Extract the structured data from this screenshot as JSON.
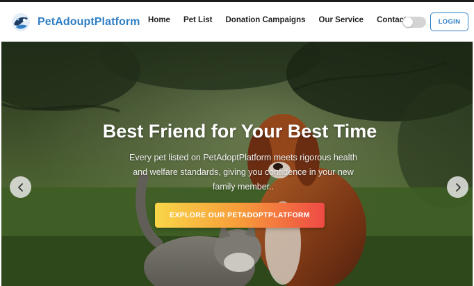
{
  "brand": {
    "name": "PetAdouptPlatform"
  },
  "nav": {
    "items": [
      {
        "label": "Home"
      },
      {
        "label": "Pet List"
      },
      {
        "label": "Donation Campaigns"
      },
      {
        "label": "Our Service"
      },
      {
        "label": "Contact"
      }
    ],
    "theme_toggle": {
      "state": "off"
    },
    "login_label": "LOGIN"
  },
  "hero": {
    "title": "Best Friend for Your Best Time",
    "subtitle": "Every pet listed on PetAdoptPlatform meets rigorous health and welfare standards, giving you confidence in your new family member..",
    "cta_label": "EXPLORE OUR PETADOPTPLATFORM",
    "prev_icon": "chevron-left-icon",
    "next_icon": "chevron-right-icon",
    "image": "dog-and-cat-on-grass"
  },
  "colors": {
    "brand": "#2f7fc4",
    "cta_gradient": [
      "#f9d648",
      "#f79c3a",
      "#ef4a45"
    ],
    "nav_text": "#1e1e1e"
  }
}
